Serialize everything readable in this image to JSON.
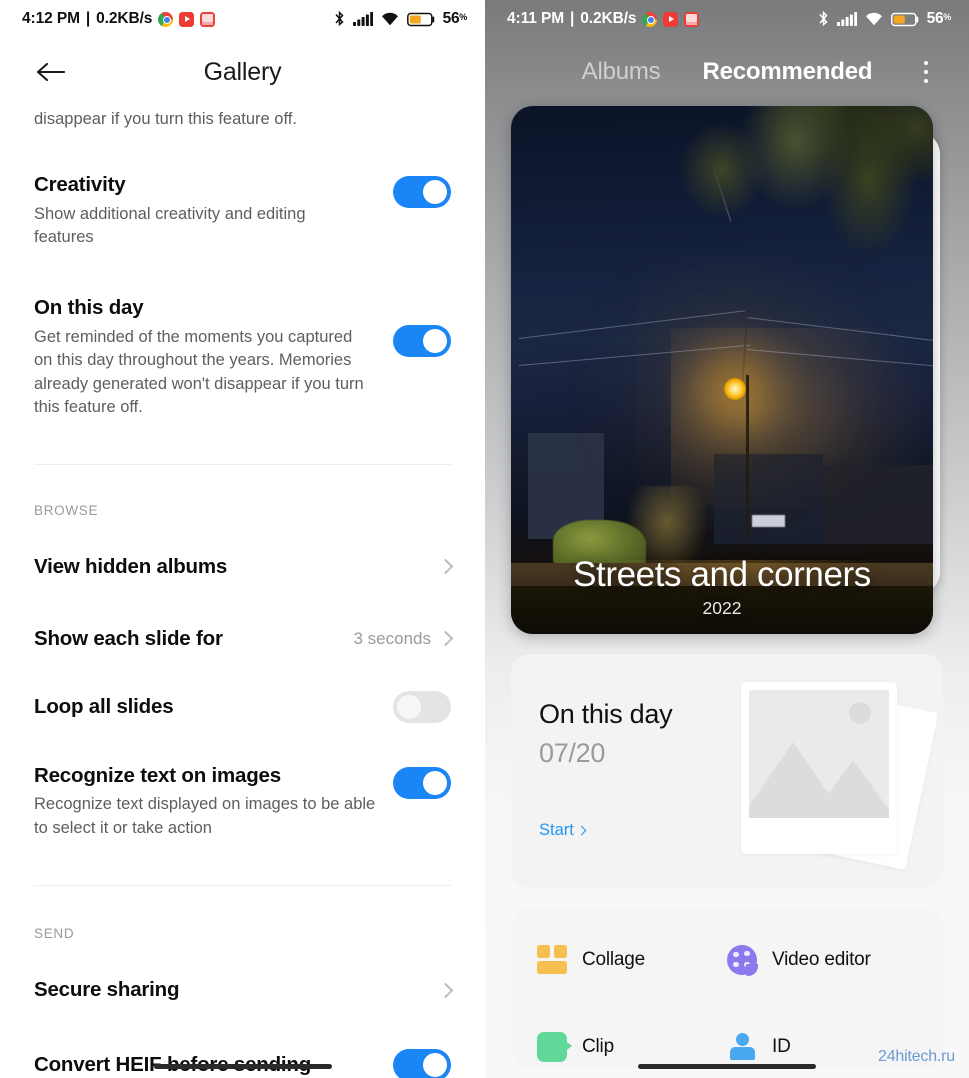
{
  "left": {
    "status_bar": {
      "time": "4:12 PM",
      "separator": "|",
      "network_speed": "0.2KB/s",
      "battery_percent": "56",
      "percent_symbol": "%",
      "app_icons": [
        "chrome-icon",
        "youtube-icon",
        "red-app-icon"
      ],
      "system_icons": [
        "bluetooth-icon",
        "signal-icon",
        "wifi-icon",
        "battery-icon"
      ]
    },
    "title": "Gallery",
    "back_icon": "back-arrow-icon",
    "partial_description": "disappear if you turn this feature off.",
    "settings": [
      {
        "title": "Creativity",
        "description": "Show additional creativity and editing features",
        "toggle": "on"
      },
      {
        "title": "On this day",
        "description": "Get reminded of the moments you captured on this day throughout the years. Memories already generated won't disappear if you turn this feature off.",
        "toggle": "on"
      }
    ],
    "browse_group_label": "BROWSE",
    "browse_items": [
      {
        "title": "View hidden albums",
        "value": "",
        "control": "chevron"
      },
      {
        "title": "Show each slide for",
        "value": "3 seconds",
        "control": "chevron"
      },
      {
        "title": "Loop all slides",
        "value": "",
        "control": "toggle-off"
      }
    ],
    "recognize": {
      "title": "Recognize text on images",
      "description": "Recognize text displayed on images to be able to select it or take action",
      "toggle": "on"
    },
    "send_group_label": "SEND",
    "send_items": [
      {
        "title": "Secure sharing",
        "control": "chevron"
      },
      {
        "title": "Convert HEIF before sending",
        "control": "toggle-on"
      }
    ]
  },
  "right": {
    "status_bar": {
      "time": "4:11 PM",
      "separator": "|",
      "network_speed": "0.2KB/s",
      "battery_percent": "56",
      "percent_symbol": "%"
    },
    "tabs": [
      {
        "label": "Albums",
        "active": false
      },
      {
        "label": "Recommended",
        "active": true
      }
    ],
    "overflow_icon": "kebab-menu-icon",
    "album": {
      "title": "Streets and corners",
      "year": "2022"
    },
    "on_this_day": {
      "title": "On this day",
      "date": "07/20",
      "action": "Start",
      "action_icon": "chevron-right-icon"
    },
    "tools": [
      {
        "label": "Collage",
        "icon": "collage-icon",
        "color": "#f6bf4f"
      },
      {
        "label": "Video editor",
        "icon": "video-editor-icon",
        "color": "#8d79ee"
      },
      {
        "label": "Clip",
        "icon": "clip-icon",
        "color": "#5fd898"
      },
      {
        "label": "ID",
        "icon": "id-photo-icon",
        "color": "#4aa8f0"
      }
    ]
  },
  "watermark": "24hitech.ru",
  "colors": {
    "accent_blue": "#1a85f5",
    "link_blue": "#2196f3",
    "toggle_off": "#e3e4e6",
    "battery_orange": "#f5a623",
    "watermark_blue": "#6c9bd1"
  }
}
